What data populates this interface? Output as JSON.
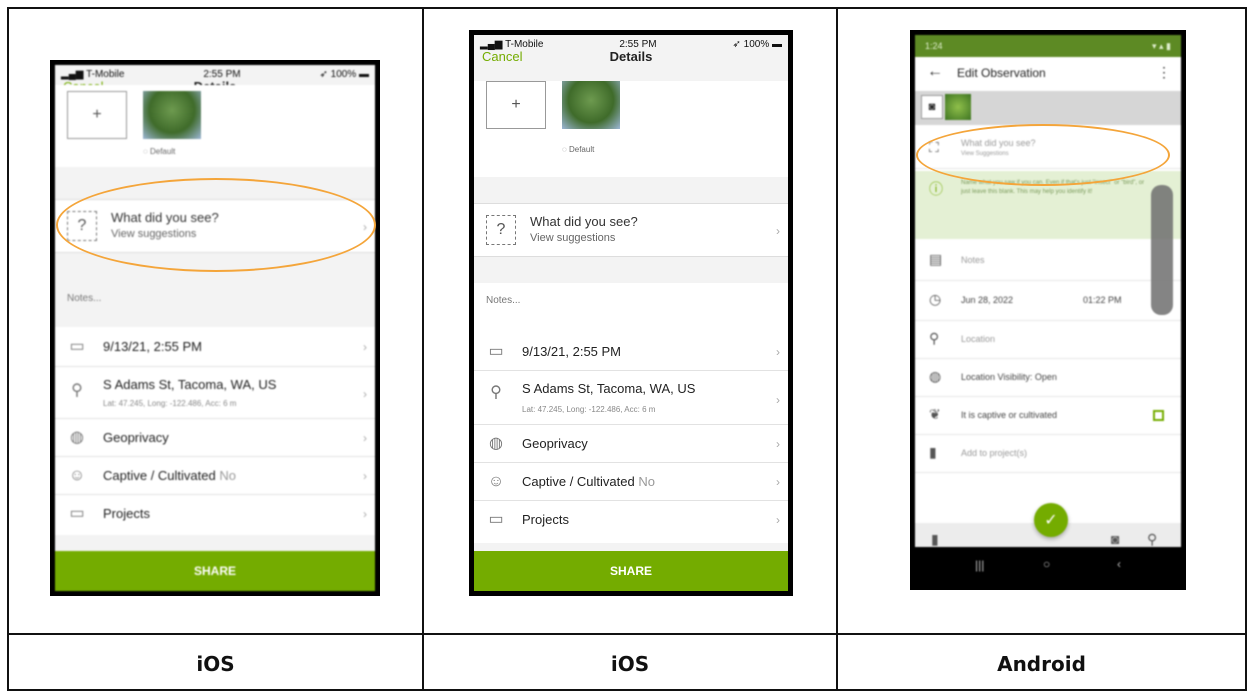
{
  "captions": [
    "iOS",
    "iOS",
    "Android"
  ],
  "ios": {
    "status": {
      "carrier": "T-Mobile",
      "signal_icon": "wifi-icon",
      "time": "2:55 PM",
      "battery": "100%"
    },
    "nav": {
      "cancel": "Cancel",
      "title": "Details"
    },
    "photos": {
      "add": "+",
      "default_label": "Default"
    },
    "what_did_you_see": {
      "title": "What did you see?",
      "subtitle": "View suggestions"
    },
    "notes_placeholder": "Notes...",
    "rows": {
      "date": "9/13/21, 2:55 PM",
      "location": "S Adams St, Tacoma, WA, US",
      "location_detail": "Lat: 47.245, Long: -122.486, Acc: 6 m",
      "geoprivacy": "Geoprivacy",
      "captive": "Captive / Cultivated",
      "captive_value": "No",
      "projects": "Projects"
    },
    "share": "SHARE",
    "accent": "#74ac00"
  },
  "android": {
    "status": {
      "time": "1:24"
    },
    "title": "Edit Observation",
    "what_did_you_see": {
      "title": "What did you see?",
      "subtitle": "View Suggestions"
    },
    "info": "Name what you saw if you can. Even if that's just \"insect\" or \"bird\", or just leave this blank. This may help you identify it!",
    "notes": "Notes",
    "date": "Jun 28, 2022",
    "time": "01:22 PM",
    "location": "Location",
    "visibility": "Location Visibility: Open",
    "captive": "It is captive or cultivated",
    "projects": "Add to project(s)"
  },
  "highlight_color": "#f4a53a"
}
